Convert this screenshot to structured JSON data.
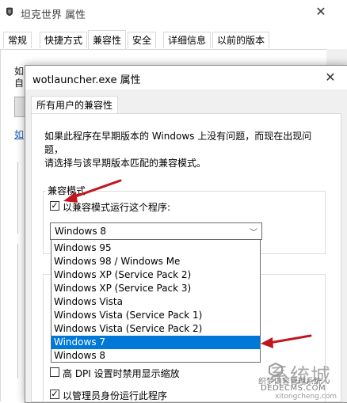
{
  "outer": {
    "title": "坦克世界 属性",
    "close": "✕",
    "tabs": [
      "常规",
      "快捷方式",
      "兼容性",
      "安全",
      "详细信息",
      "以前的版本"
    ],
    "active_tab": 2,
    "frag1": "如",
    "frag2": "自",
    "link": "如"
  },
  "dialog": {
    "title": "wotlauncher.exe 属性",
    "close": "✕",
    "tab": "所有用户的兼容性",
    "description_line1": "如果此程序在早期版本的 Windows 上没有问题，而现在出现问题，",
    "description_line2": "请选择与该早期版本匹配的兼容模式。",
    "compat_group_label": "兼容模式",
    "compat_checkbox_label": "以兼容模式运行这个程序:",
    "compat_checked": true,
    "combo_value": "Windows 8",
    "combo_arrow": "﹀",
    "options": [
      "Windows 95",
      "Windows 98 / Windows Me",
      "Windows XP (Service Pack 2)",
      "Windows XP (Service Pack 3)",
      "Windows Vista",
      "Windows Vista (Service Pack 1)",
      "Windows Vista (Service Pack 2)",
      "Windows 7",
      "Windows 8"
    ],
    "selected_option": "Windows 7",
    "dpi_checkbox_label": "高 DPI 设置时禁用显示缩放",
    "dpi_checked": false,
    "admin_checkbox_label": "以管理员身份运行此程序",
    "admin_checked": true,
    "check_mark": "✓"
  },
  "watermark": {
    "brand": "系统城",
    "line1": "织梦内容管理系统",
    "line2": "DEDECMS.COM",
    "line3": "xitongcheng.com"
  },
  "colors": {
    "selection": "#0078d7",
    "arrow": "#c0171f"
  }
}
